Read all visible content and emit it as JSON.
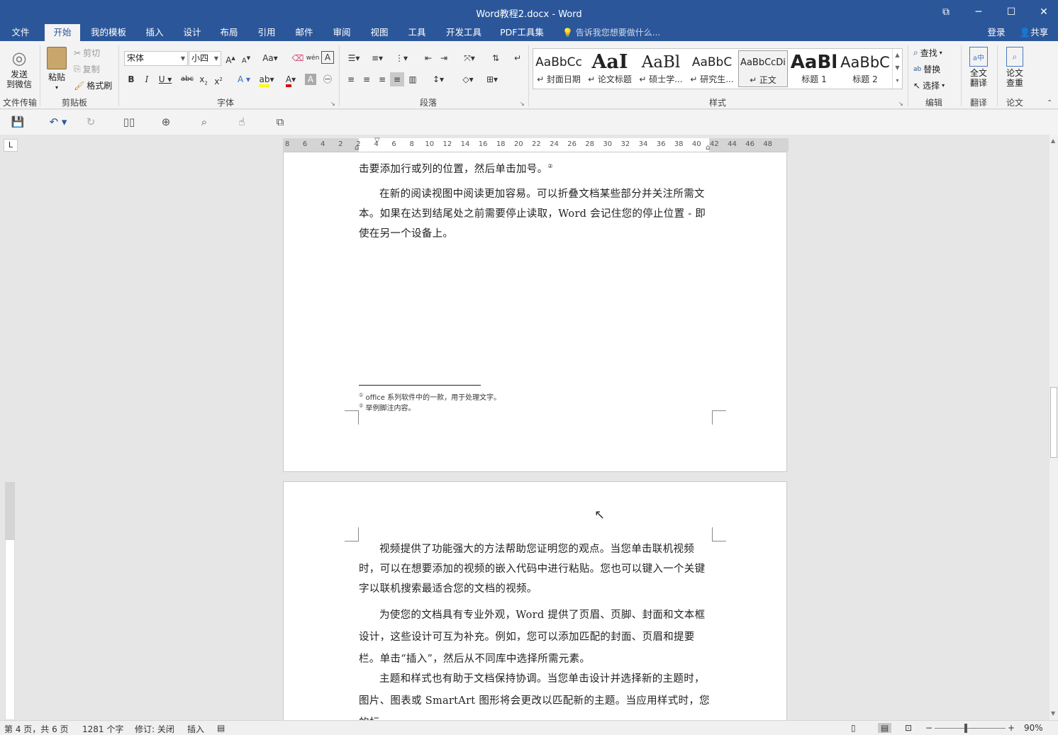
{
  "window": {
    "title": "Word教程2.docx - Word"
  },
  "tabs": [
    {
      "label": "文件"
    },
    {
      "label": "开始"
    },
    {
      "label": "我的模板"
    },
    {
      "label": "插入"
    },
    {
      "label": "设计"
    },
    {
      "label": "布局"
    },
    {
      "label": "引用"
    },
    {
      "label": "邮件"
    },
    {
      "label": "审阅"
    },
    {
      "label": "视图"
    },
    {
      "label": "工具"
    },
    {
      "label": "开发工具"
    },
    {
      "label": "PDF工具集"
    }
  ],
  "tell_me": "告诉我您想要做什么...",
  "account": {
    "login": "登录",
    "share": "共享"
  },
  "ribbon": {
    "send_wechat": "发送\n到微信",
    "file_transfer": "文件传输",
    "paste": "粘贴",
    "cut": "剪切",
    "copy": "复制",
    "format_painter": "格式刷",
    "clipboard": "剪贴板",
    "font_name": "宋体",
    "font_size": "小四",
    "font_group": "字体",
    "paragraph_group": "段落",
    "styles_group": "样式",
    "styles": [
      {
        "sample": "AaBbCc",
        "name": "↵ 封面日期"
      },
      {
        "sample": "AaI",
        "name": "↵ 论文标题"
      },
      {
        "sample": "AaBl",
        "name": "↵ 硕士学..."
      },
      {
        "sample": "AaBbC",
        "name": "↵ 研究生..."
      },
      {
        "sample": "AaBbCcDi",
        "name": "↵ 正文"
      },
      {
        "sample": "AaBl",
        "name": "标题 1"
      },
      {
        "sample": "AaBbC",
        "name": "标题 2"
      }
    ],
    "find": "查找",
    "replace": "替换",
    "select": "选择",
    "edit_group": "编辑",
    "translate_full": "全文\n翻译",
    "translate_group": "翻译",
    "paper_check": "论文\n查重",
    "paper_group": "论文"
  },
  "ruler": {
    "numbers": [
      "8",
      "6",
      "4",
      "2",
      "2",
      "4",
      "6",
      "8",
      "10",
      "12",
      "14",
      "16",
      "18",
      "20",
      "22",
      "24",
      "26",
      "28",
      "30",
      "32",
      "34",
      "36",
      "38",
      "40",
      "42",
      "44",
      "46",
      "48"
    ]
  },
  "page1": {
    "line_top": "击要添加行或列的位置，然后单击加号。",
    "footnote_ref": "②",
    "para1": "在新的阅读视图中阅读更加容易。可以折叠文档某些部分并关注所需文本。如果在达到结尾处之前需要停止读取，Word 会记住您的停止位置 - 即使在另一个设备上。",
    "footnotes": [
      {
        "mark": "①",
        "text": "office 系列软件中的一款，用于处理文字。"
      },
      {
        "mark": "②",
        "text": "举例脚注内容。"
      }
    ]
  },
  "page2": {
    "paras": [
      "视频提供了功能强大的方法帮助您证明您的观点。当您单击联机视频时，可以在想要添加的视频的嵌入代码中进行粘贴。您也可以键入一个关键字以联机搜索最适合您的文档的视频。",
      "为使您的文档具有专业外观，Word 提供了页眉、页脚、封面和文本框设计，这些设计可互为补充。例如，您可以添加匹配的封面、页眉和提要栏。单击“插入”，然后从不同库中选择所需元素。",
      "主题和样式也有助于文档保持协调。当您单击设计并选择新的主题时，图片、图表或 SmartArt 图形将会更改以匹配新的主题。当应用样式时，您的标"
    ]
  },
  "status": {
    "page": "第 4 页，共 6 页",
    "words": "1281 个字",
    "track": "修订: 关闭",
    "mode": "插入",
    "zoom": "90%"
  },
  "colors": {
    "brand": "#2b579a",
    "highlight": "#ffff00",
    "font_color": "#e00000"
  }
}
